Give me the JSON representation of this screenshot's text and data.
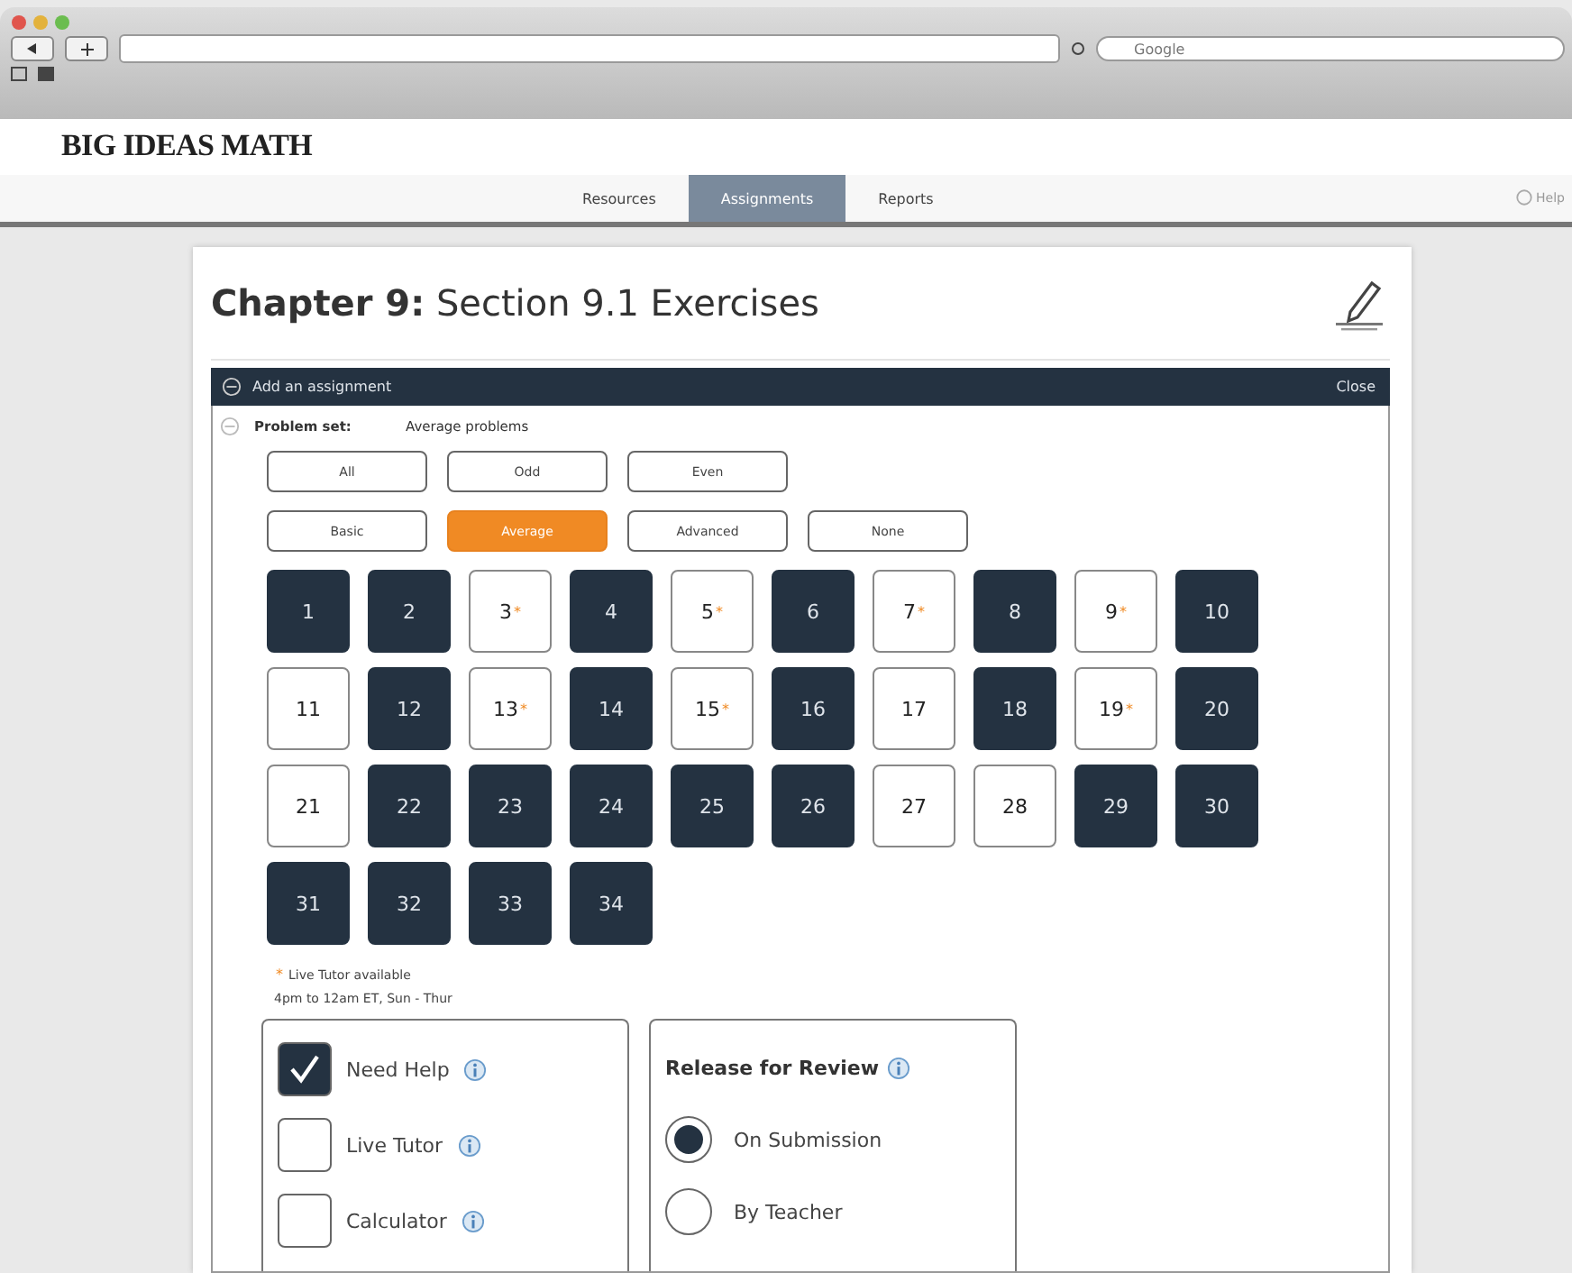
{
  "browser": {
    "search_placeholder": "Google"
  },
  "site": {
    "logo": "BIG IDEAS MATH"
  },
  "nav": {
    "tabs": [
      {
        "label": "Resources",
        "selected": false
      },
      {
        "label": "Assignments",
        "selected": true
      },
      {
        "label": "Reports",
        "selected": false
      }
    ],
    "help": "Help"
  },
  "page": {
    "title_bold": "Chapter 9:",
    "title_rest": "Section 9.1 Exercises"
  },
  "panel": {
    "header": "Add an assignment",
    "close": "Close",
    "problem_set_label": "Problem set:",
    "problem_set_value": "Average problems"
  },
  "filter_rows": [
    [
      {
        "label": "All",
        "selected": false
      },
      {
        "label": "Odd",
        "selected": false
      },
      {
        "label": "Even",
        "selected": false
      }
    ],
    [
      {
        "label": "Basic",
        "selected": false
      },
      {
        "label": "Average",
        "selected": true
      },
      {
        "label": "Advanced",
        "selected": false
      },
      {
        "label": "None",
        "selected": false
      }
    ]
  ],
  "problems": [
    {
      "label": "1",
      "selected": true
    },
    {
      "label": "2",
      "selected": true
    },
    {
      "label": "3",
      "selected": false,
      "note": "*"
    },
    {
      "label": "4",
      "selected": true
    },
    {
      "label": "5",
      "selected": false,
      "note": "*"
    },
    {
      "label": "6",
      "selected": true
    },
    {
      "label": "7",
      "selected": false,
      "note": "*"
    },
    {
      "label": "8",
      "selected": true
    },
    {
      "label": "9",
      "selected": false,
      "note": "*"
    },
    {
      "label": "10",
      "selected": true
    },
    {
      "label": "11",
      "selected": false
    },
    {
      "label": "12",
      "selected": true
    },
    {
      "label": "13",
      "selected": false,
      "note": "*"
    },
    {
      "label": "14",
      "selected": true
    },
    {
      "label": "15",
      "selected": false,
      "note": "*"
    },
    {
      "label": "16",
      "selected": true
    },
    {
      "label": "17",
      "selected": false
    },
    {
      "label": "18",
      "selected": true
    },
    {
      "label": "19",
      "selected": false,
      "note": "*"
    },
    {
      "label": "20",
      "selected": true
    },
    {
      "label": "21",
      "selected": false
    },
    {
      "label": "22",
      "selected": true
    },
    {
      "label": "23",
      "selected": true
    },
    {
      "label": "24",
      "selected": true
    },
    {
      "label": "25",
      "selected": true
    },
    {
      "label": "26",
      "selected": true
    },
    {
      "label": "27",
      "selected": false
    },
    {
      "label": "28",
      "selected": false
    },
    {
      "label": "29",
      "selected": true
    },
    {
      "label": "30",
      "selected": true
    },
    {
      "label": "31",
      "selected": true
    },
    {
      "label": "32",
      "selected": true
    },
    {
      "label": "33",
      "selected": true
    },
    {
      "label": "34",
      "selected": true
    }
  ],
  "footnote": {
    "mark": "*",
    "line1": "Live Tutor available",
    "line2": "4pm to 12am ET, Sun - Thur"
  },
  "options": [
    {
      "label": "Need Help",
      "checked": true
    },
    {
      "label": "Live Tutor",
      "checked": false
    },
    {
      "label": "Calculator",
      "checked": false
    }
  ],
  "release": {
    "title": "Release for Review",
    "choices": [
      {
        "label": "On Submission",
        "selected": true
      },
      {
        "label": "By Teacher",
        "selected": false
      }
    ]
  }
}
